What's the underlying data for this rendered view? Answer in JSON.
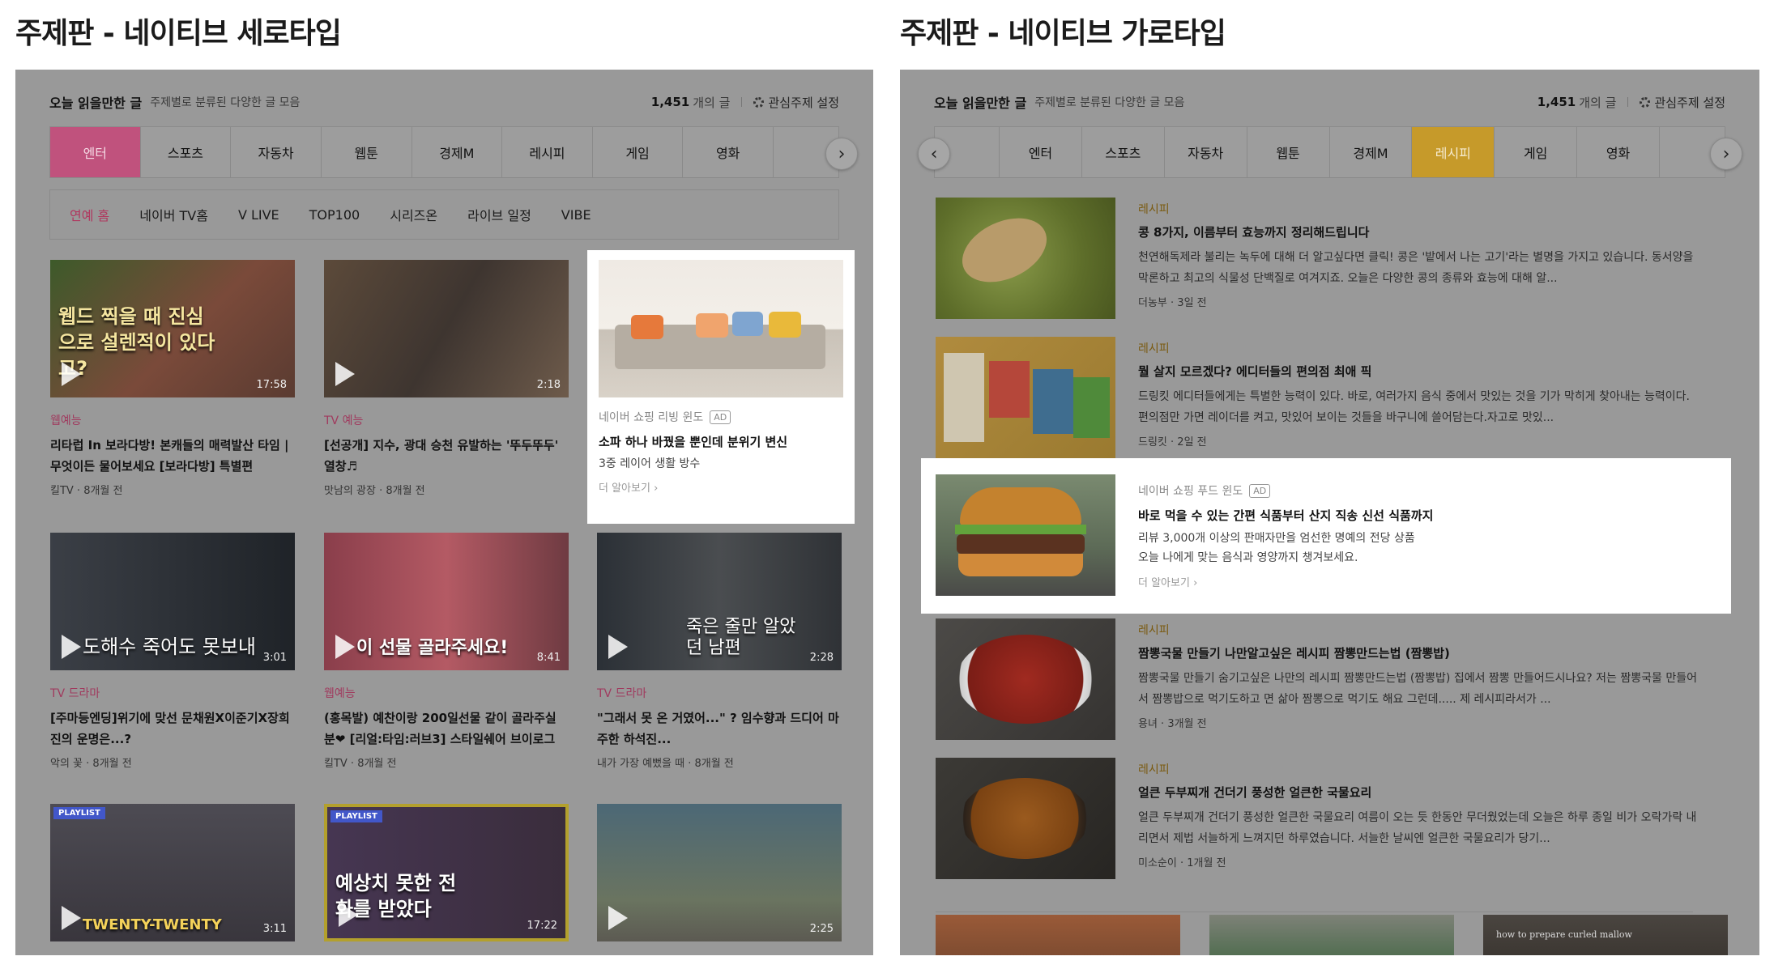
{
  "headings": {
    "left": "주제판 - 네이티브 세로타입",
    "right": "주제판 - 네이티브 가로타입"
  },
  "topbar": {
    "title": "오늘 읽을만한 글",
    "subtitle": "주제별로 분류된 다양한 글 모음",
    "count": "1,451",
    "count_unit": "개의 글",
    "settings_label": "관심주제 설정"
  },
  "tabs": [
    "엔터",
    "스포츠",
    "자동차",
    "웹툰",
    "경제M",
    "레시피",
    "게임",
    "영화"
  ],
  "left_active_tab": "엔터",
  "right_active_tab": "레시피",
  "arrows": {
    "prev": "‹",
    "next": "›"
  },
  "subtabs": [
    "연예 홈",
    "네이버 TV홈",
    "V LIVE",
    "TOP100",
    "시리즈온",
    "라이브 일정",
    "VIBE"
  ],
  "videos": [
    {
      "thumb_text": "웹드 찍을 때 진심으로 설렌적이 있다고?",
      "duration": "17:58",
      "category": "웹예능",
      "title": "리타럽 In 보라다방! 본캐들의 매력발산 타임 | 무엇이든 물어보세요 [보라다방] 특별편",
      "channel": "킬TV",
      "age": "8개월 전"
    },
    {
      "thumb_text": "",
      "duration": "2:18",
      "category": "TV 예능",
      "title": "[선공개] 지수, 광대 승천 유발하는 '뚜두뚜두' 열창♬",
      "channel": "맛남의 광장",
      "age": "8개월 전"
    },
    {
      "thumb_text": "도해수 죽어도 못보내",
      "duration": "3:01",
      "category": "TV 드라마",
      "title": "[주마등엔딩]위기에 맞선 문채원X이준기X장희진의 운명은...?",
      "channel": "악의 꽃",
      "age": "8개월 전"
    },
    {
      "thumb_text": "이 선물 골라주세요!",
      "duration": "8:41",
      "category": "웹예능",
      "title": "(홍목발) 예찬이랑 200일선물 같이 골라주실 분❤ [리얼:타임:러브3] 스타일쉐어 브이로그",
      "channel": "킬TV",
      "age": "8개월 전"
    },
    {
      "thumb_text": "죽은 줄만 알았던 남편",
      "duration": "2:28",
      "category": "TV 드라마",
      "title": "\"그래서 못 온 거였어...\" ? 임수향과 드디어 마주한 하석진...",
      "channel": "내가 가장 예뻤을 때",
      "age": "8개월 전"
    },
    {
      "thumb_text": "TWENTY-TWENTY",
      "duration": "3:11",
      "badge": "PLAYLIST"
    },
    {
      "thumb_text": "예상치 못한 전화를 받았다",
      "duration": "17:22",
      "badge": "PLAYLIST"
    },
    {
      "thumb_text": "",
      "duration": "2:25"
    }
  ],
  "left_ad": {
    "label": "네이버 쇼핑 리빙 윈도",
    "badge": "AD",
    "title": "소파 하나 바꿨을 뿐인데 분위기 변신",
    "desc": "3중 레이어 생활 방수",
    "more": "더 알아보기 ›"
  },
  "feed": [
    {
      "category": "레시피",
      "title": "콩 8가지, 이름부터 효능까지 정리해드립니다",
      "desc": "천연해독제라 불리는 녹두에 대해 더 알고싶다면 클릭! 콩은 '밭에서 나는 고기'라는 별명을 가지고 있습니다. 동서양을 막론하고 최고의 식물성 단백질로 여겨지죠. 오늘은 다양한 콩의 종류와 효능에 대해 알...",
      "source": "더농부",
      "age": "3일 전"
    },
    {
      "category": "레시피",
      "title": "뭘 살지 모르겠다? 에디터들의 편의점 최애 픽",
      "desc": "드링킷 에디터들에게는 특별한 능력이 있다. 바로, 여러가지 음식 중에서 맛있는 것을 기가 막히게 찾아내는 능력이다. 편의점만 가면 레이더를 켜고, 맛있어 보이는 것들을 바구니에 쓸어담는다.자고로 맛있...",
      "source": "드링킷",
      "age": "2일 전"
    },
    {
      "category": "레시피",
      "title": "짬뽕국물 만들기 나만알고싶은 레시피 짬뽕만드는법 (짬뽕밥)",
      "desc": "짬뽕국물 만들기 숨기고싶은 나만의 레시피 짬뽕만드는법 (짬뽕밥) 집에서 짬뽕 만들어드시나요? 저는 짬뽕국물 만들어서 짬뽕밥으로 먹기도하고 면 삶아 짬뽕으로 먹기도 해요 그런데..... 제 레시피라서가 ...",
      "source": "용녀",
      "age": "3개월 전"
    },
    {
      "category": "레시피",
      "title": "얼큰 두부찌개 건더기 풍성한 얼큰한 국물요리",
      "desc": "얼큰 두부찌개 건더기 풍성한 얼큰한 국물요리 여름이 오는 듯 한동안 무더웠었는데 오늘은 하루 종일 비가 오락가락 내리면서 제법 서늘하게 느껴지던 하루였습니다. 서늘한 날씨엔 얼큰한 국물요리가 당기...",
      "source": "미소순이",
      "age": "1개월 전"
    }
  ],
  "right_ad": {
    "label": "네이버 쇼핑 푸드 윈도",
    "badge": "AD",
    "title": "바로 먹을 수 있는 간편 식품부터 산지 직송 신선 식품까지",
    "desc1": "리뷰 3,000개 이상의 판매자만을 엄선한 명예의 전당 상품",
    "desc2": "오늘 나에게 맞는 음식과 영양까지 챙겨보세요.",
    "more": "더 알아보기 ›"
  },
  "bottom_thumb_text": "how to prepare curled mallow",
  "colors": {
    "overlay": "#999999",
    "active_pink": "#c0527d",
    "active_gold": "#c69a2a",
    "ad_bg": "#ffffff"
  }
}
